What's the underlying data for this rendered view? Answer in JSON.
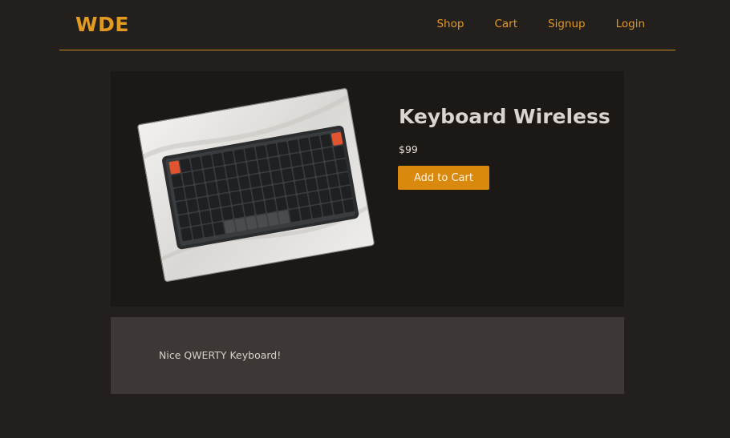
{
  "brand": "WDE",
  "nav": {
    "items": [
      {
        "label": "Shop"
      },
      {
        "label": "Cart"
      },
      {
        "label": "Signup"
      },
      {
        "label": "Login"
      }
    ]
  },
  "product": {
    "title": "Keyboard Wireless",
    "price": "$99",
    "add_to_cart_label": "Add to Cart",
    "description": "Nice QWERTY Keyboard!"
  },
  "colors": {
    "background": "#221f1d",
    "accent": "#e39a20",
    "card": "#1b1816",
    "description_card": "#3d3836"
  },
  "icons": {
    "product_image": "keyboard-photo"
  }
}
